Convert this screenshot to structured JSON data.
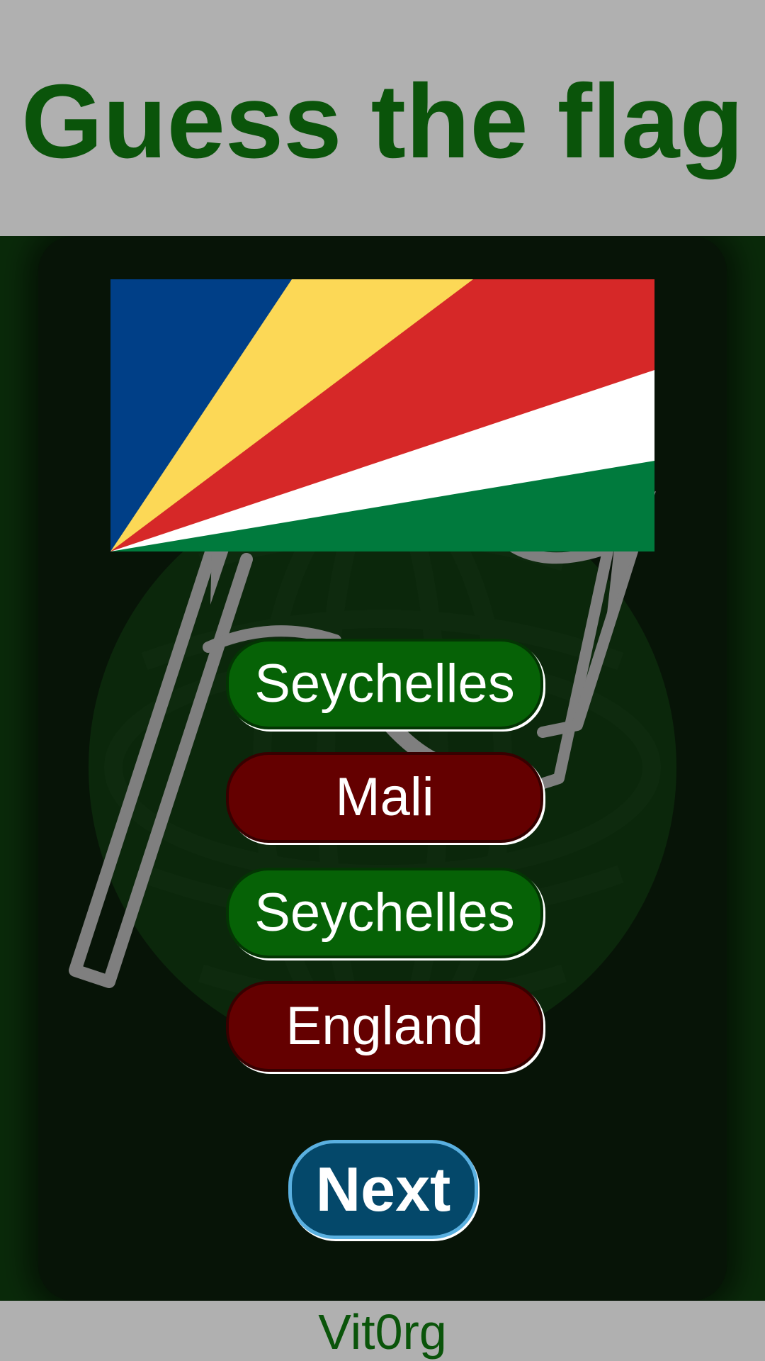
{
  "header": {
    "title": "Guess the flag"
  },
  "flag": {
    "icon": "seychelles-flag",
    "colors": {
      "blue": "#003f87",
      "yellow": "#fcd856",
      "red": "#d62828",
      "white": "#ffffff",
      "green": "#007a3d"
    }
  },
  "answers": [
    {
      "label": "Seychelles",
      "state": "correct",
      "color": "#066206"
    },
    {
      "label": "Mali",
      "state": "wrong",
      "color": "#640000"
    },
    {
      "label": "Seychelles",
      "state": "correct",
      "color": "#066206"
    },
    {
      "label": "England",
      "state": "wrong",
      "color": "#640000"
    }
  ],
  "next_button": {
    "label": "Next",
    "color": "#04486a",
    "border_color": "#5ab0e0"
  },
  "footer": {
    "brand": "Vit0rg"
  },
  "colors": {
    "title": "#0a540a",
    "background": "#b0b0b0",
    "stage": "#0a2a0a",
    "card": "#071407"
  }
}
